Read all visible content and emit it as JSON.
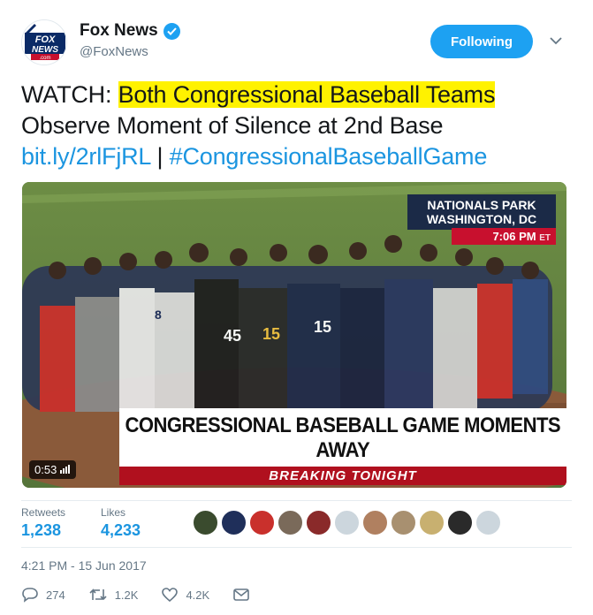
{
  "author": {
    "display_name": "Fox News",
    "handle": "@FoxNews",
    "logo_text_top": "FOX",
    "logo_text_bottom": "NEWS",
    "logo_text_com": ".com",
    "verified_icon": "verified-badge-icon"
  },
  "follow_button": {
    "label": "Following"
  },
  "tweet": {
    "prefix": "WATCH: ",
    "highlighted": "Both Congressional Baseball Teams",
    "line2": "Observe Moment of Silence at 2nd Base",
    "link": "bit.ly/2rlFjRL",
    "separator": " | ",
    "hashtag": "#CongressionalBaseballGame"
  },
  "media": {
    "location_line1": "NATIONALS PARK",
    "location_line2": "WASHINGTON, DC",
    "time": "7:06 PM",
    "timezone": "ET",
    "headline": "CONGRESSIONAL BASEBALL GAME MOMENTS AWAY",
    "breaking": "BREAKING TONIGHT",
    "duration": "0:53"
  },
  "stats": {
    "retweets_label": "Retweets",
    "retweets_value": "1,238",
    "likes_label": "Likes",
    "likes_value": "4,233"
  },
  "timestamp": "4:21 PM - 15 Jun 2017",
  "actions": {
    "reply_count": "274",
    "retweet_count": "1.2K",
    "like_count": "4.2K"
  },
  "colors": {
    "brand_blue": "#1da1f2",
    "link_blue": "#1b95e0",
    "highlight": "#fff200",
    "breaking_red": "#b0101e"
  }
}
